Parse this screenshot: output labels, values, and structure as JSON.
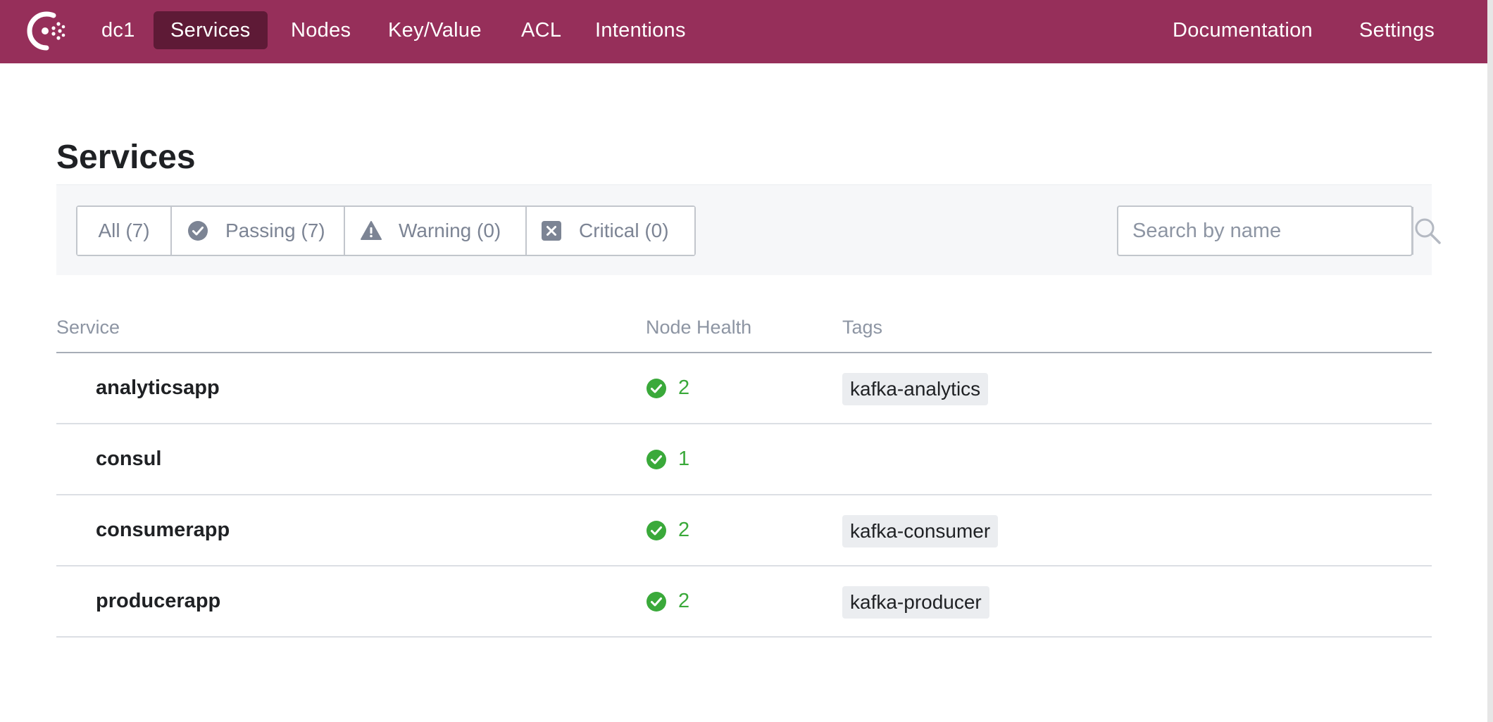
{
  "nav": {
    "datacenter": "dc1",
    "items": [
      {
        "label": "Services"
      },
      {
        "label": "Nodes"
      },
      {
        "label": "Key/Value"
      },
      {
        "label": "ACL"
      },
      {
        "label": "Intentions"
      }
    ],
    "right": [
      {
        "label": "Documentation"
      },
      {
        "label": "Settings"
      }
    ],
    "active": "Services",
    "color": "#962f5a",
    "active_color": "#5e1a36"
  },
  "page": {
    "title": "Services"
  },
  "filters": [
    {
      "label": "All (7)",
      "icon": "none"
    },
    {
      "label": "Passing (7)",
      "icon": "check-circle-icon"
    },
    {
      "label": "Warning (0)",
      "icon": "warning-triangle-icon"
    },
    {
      "label": "Critical (0)",
      "icon": "critical-x-icon"
    }
  ],
  "search": {
    "placeholder": "Search by name",
    "value": ""
  },
  "table": {
    "columns": [
      "Service",
      "Node Health",
      "Tags"
    ],
    "rows": [
      {
        "service": "analyticsapp",
        "health": "2",
        "tag": "kafka-analytics"
      },
      {
        "service": "consul",
        "health": "1",
        "tag": ""
      },
      {
        "service": "consumerapp",
        "health": "2",
        "tag": "kafka-consumer"
      },
      {
        "service": "producerapp",
        "health": "2",
        "tag": "kafka-producer"
      }
    ]
  },
  "colors": {
    "passing": "#3aa93a",
    "muted": "#8d95a3"
  }
}
